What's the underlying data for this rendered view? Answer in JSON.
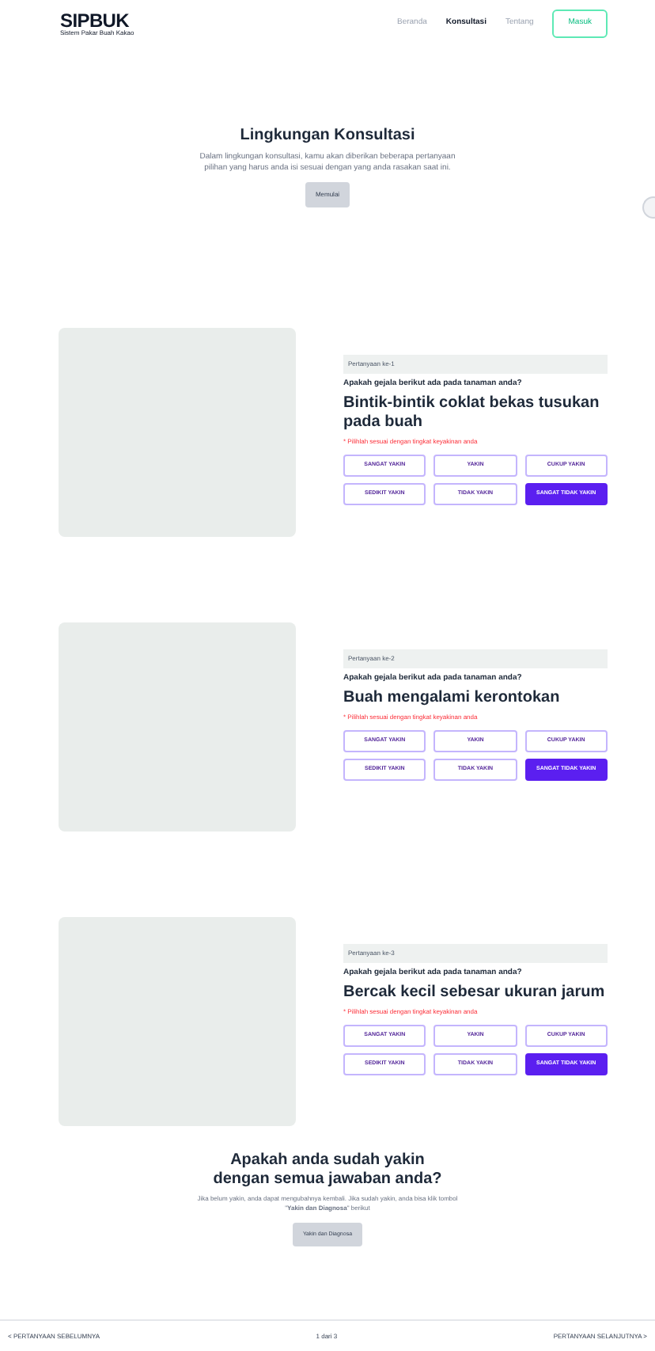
{
  "header": {
    "logo": "SIPBUK",
    "tagline": "Sistem Pakar Buah Kakao",
    "nav": [
      {
        "label": "Beranda",
        "selected": false
      },
      {
        "label": "Konsultasi",
        "selected": true
      },
      {
        "label": "Tentang",
        "selected": false
      }
    ],
    "login": "Masuk"
  },
  "hero": {
    "title": "Lingkungan Konsultasi",
    "description": "Dalam lingkungan konsultasi, kamu akan diberikan beberapa pertanyaan pilihan yang harus anda isi sesuai dengan yang anda rasakan saat ini.",
    "button": "Memulai"
  },
  "questions": [
    {
      "number": "Pertanyaan ke-1",
      "prompt": "Apakah gejala berikut ada pada tanaman anda?",
      "symptom": "Bintik-bintik coklat bekas tusukan pada buah",
      "note": "* Pilihlah sesuai dengan tingkat keyakinan anda",
      "options": [
        {
          "label": "SANGAT YAKIN",
          "selected": false
        },
        {
          "label": "YAKIN",
          "selected": false
        },
        {
          "label": "CUKUP YAKIN",
          "selected": false
        },
        {
          "label": "SEDIKIT YAKIN",
          "selected": false
        },
        {
          "label": "TIDAK YAKIN",
          "selected": false
        },
        {
          "label": "SANGAT TIDAK YAKIN",
          "selected": true
        }
      ]
    },
    {
      "number": "Pertanyaan ke-2",
      "prompt": "Apakah gejala berikut ada pada tanaman anda?",
      "symptom": "Buah mengalami kerontokan",
      "note": "* Pilihlah sesuai dengan tingkat keyakinan anda",
      "options": [
        {
          "label": "SANGAT YAKIN",
          "selected": false
        },
        {
          "label": "YAKIN",
          "selected": false
        },
        {
          "label": "CUKUP YAKIN",
          "selected": false
        },
        {
          "label": "SEDIKIT YAKIN",
          "selected": false
        },
        {
          "label": "TIDAK YAKIN",
          "selected": false
        },
        {
          "label": "SANGAT TIDAK YAKIN",
          "selected": true
        }
      ]
    },
    {
      "number": "Pertanyaan ke-3",
      "prompt": "Apakah gejala berikut ada pada tanaman anda?",
      "symptom": "Bercak kecil sebesar ukuran jarum",
      "note": "* Pilihlah sesuai dengan tingkat keyakinan anda",
      "options": [
        {
          "label": "SANGAT YAKIN",
          "selected": false
        },
        {
          "label": "YAKIN",
          "selected": false
        },
        {
          "label": "CUKUP YAKIN",
          "selected": false
        },
        {
          "label": "SEDIKIT YAKIN",
          "selected": false
        },
        {
          "label": "TIDAK YAKIN",
          "selected": false
        },
        {
          "label": "SANGAT TIDAK YAKIN",
          "selected": true
        }
      ]
    }
  ],
  "confirm": {
    "title": "Apakah anda sudah yakin dengan semua jawaban anda?",
    "description": "Jika belum yakin, anda dapat mengubahnya kembali. Jika sudah yakin, anda bisa klik tombol \"**Yakin dan Diagnosa**\" berikut",
    "button": "Yakin dan Diagnosa"
  },
  "footer": {
    "previous": "< PERTANYAAN SEBELUMNYA",
    "page": "1 dari 3",
    "next": "PERTANYAAN SELANJUTNYA >"
  }
}
